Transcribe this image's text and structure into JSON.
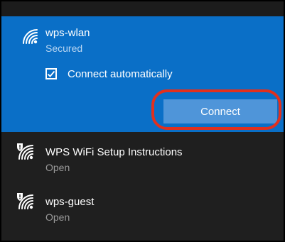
{
  "networks": [
    {
      "name": "wps-wlan",
      "status": "Secured",
      "icon": "wifi-signal-icon",
      "selected": true,
      "connect_automatically_label": "Connect automatically",
      "connect_automatically_checked": true,
      "connect_button_label": "Connect"
    },
    {
      "name": "WPS WiFi Setup Instructions",
      "status": "Open",
      "icon": "wifi-open-warning-icon"
    },
    {
      "name": "wps-guest",
      "status": "Open",
      "icon": "wifi-open-warning-icon"
    }
  ],
  "colors": {
    "selected_bg": "#0a6fc7",
    "connect_button_bg": "#4f95d9",
    "highlight_ring": "#e0301e",
    "panel_bg": "#1f1f1f"
  }
}
